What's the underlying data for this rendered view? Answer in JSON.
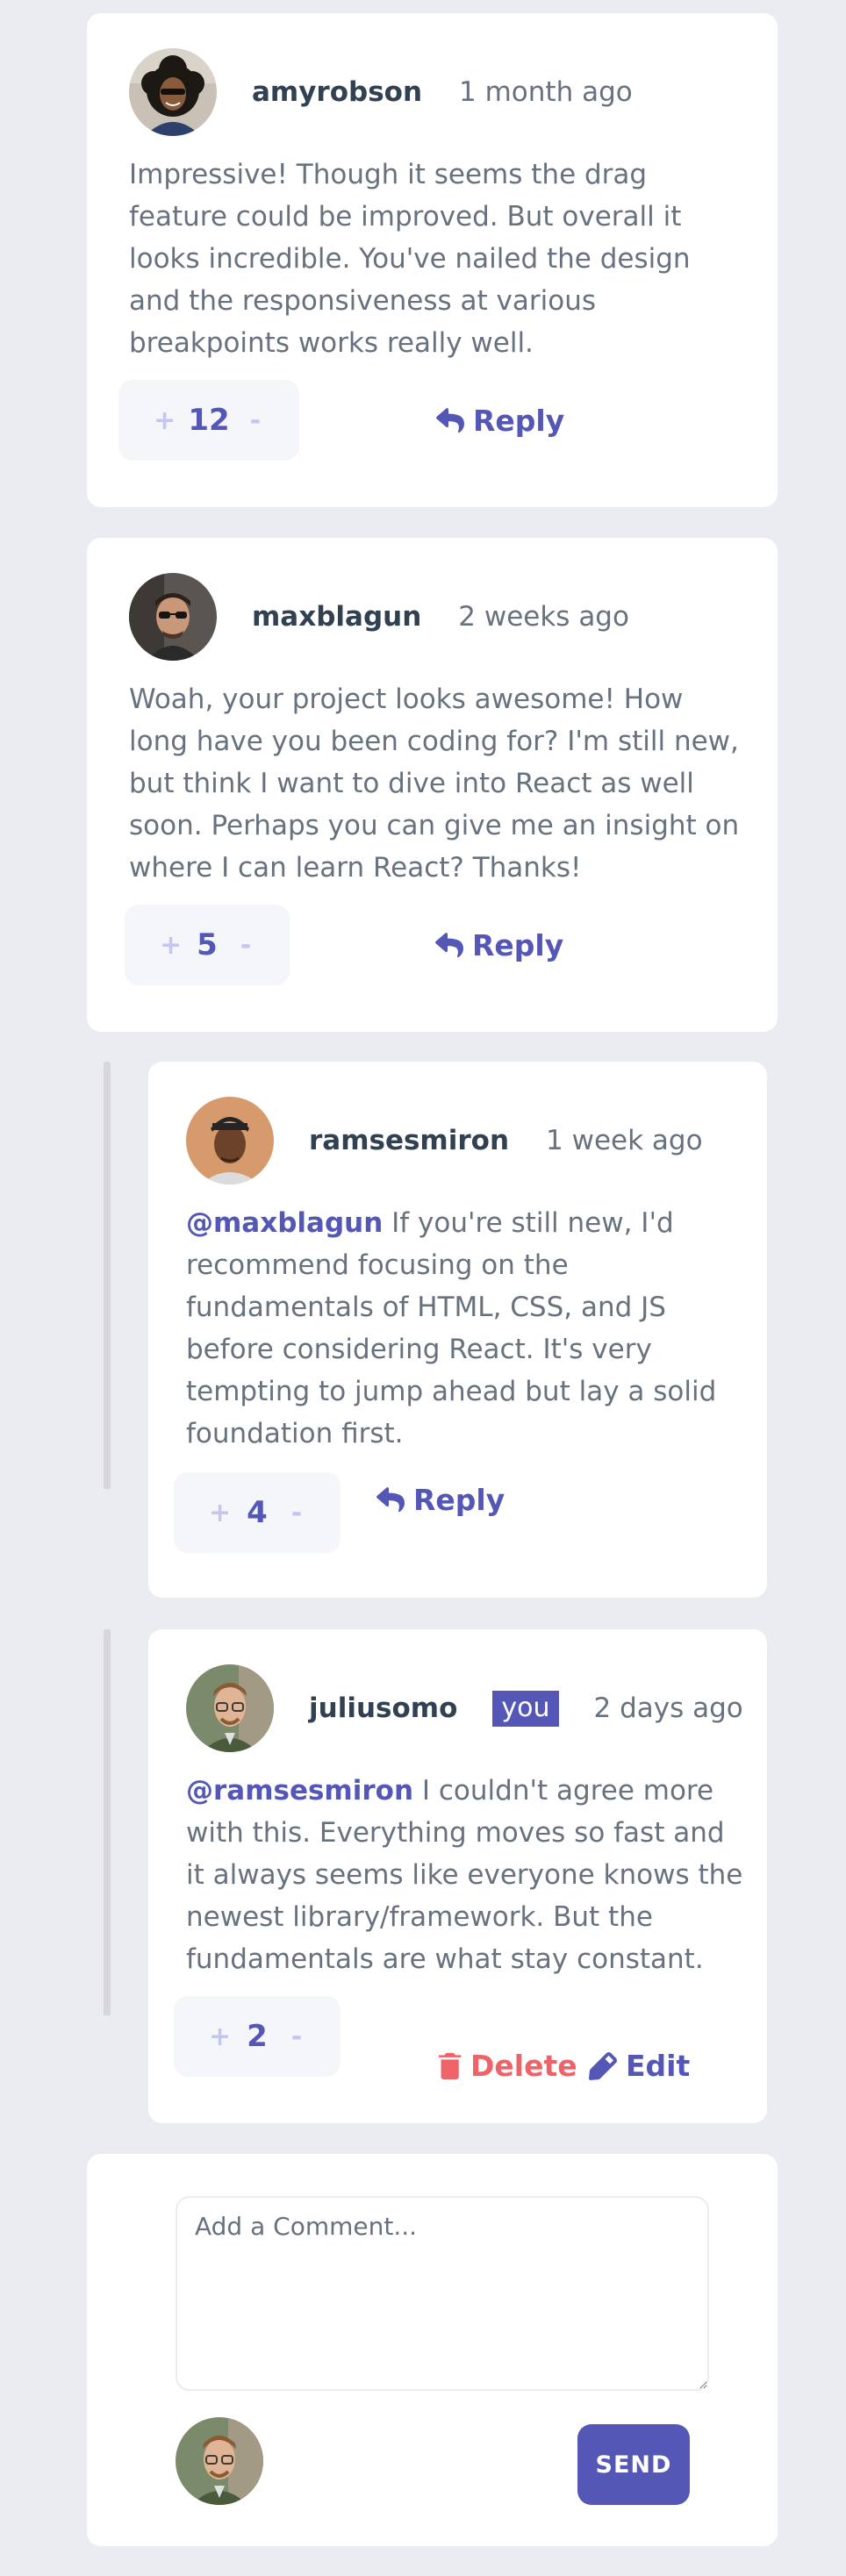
{
  "colors": {
    "primary": "#5457b6",
    "danger": "#ed6368",
    "text": "#67727e",
    "heading": "#324152",
    "background": "#eaecf1",
    "vote_background": "#f5f6fa",
    "vote_button": "#c5c6ef"
  },
  "icons": {
    "reply": "reply-arrow-icon",
    "delete": "trash-icon",
    "edit": "pencil-icon",
    "upvote": "plus",
    "downvote": "minus"
  },
  "comments": [
    {
      "username": "amyrobson",
      "timestamp": "1 month ago",
      "content": "Impressive! Though it seems the drag feature could be improved. But overall it looks incredible. You've nailed the design and the responsiveness at various breakpoints works really well.",
      "score": "12",
      "upvote_label": "+",
      "downvote_label": "-",
      "reply_label": "Reply"
    },
    {
      "username": "maxblagun",
      "timestamp": "2 weeks ago",
      "content": "Woah, your project looks awesome! How long have you been coding for? I'm still new, but think I want to dive into React as well soon. Perhaps you can give me an insight on where I can learn React? Thanks!",
      "score": "5",
      "upvote_label": "+",
      "downvote_label": "-",
      "reply_label": "Reply",
      "replies": [
        {
          "username": "ramsesmiron",
          "timestamp": "1 week ago",
          "mention": "@maxblagun",
          "content": "If you're still new, I'd recommend focusing on the fundamentals of HTML, CSS, and JS before considering React. It's very tempting to jump ahead but lay a solid foundation first.",
          "score": "4",
          "upvote_label": "+",
          "downvote_label": "-",
          "reply_label": "Reply"
        },
        {
          "username": "juliusomo",
          "you_badge": "you",
          "timestamp": "2 days ago",
          "mention": "@ramsesmiron",
          "content": "I couldn't agree more with this. Everything moves so fast and it always seems like everyone knows the newest library/framework. But the fundamentals are what stay constant.",
          "score": "2",
          "upvote_label": "+",
          "downvote_label": "-",
          "delete_label": "Delete",
          "edit_label": "Edit"
        }
      ]
    }
  ],
  "new_comment": {
    "placeholder": "Add a Comment...",
    "value": "",
    "send_label": "SEND"
  }
}
